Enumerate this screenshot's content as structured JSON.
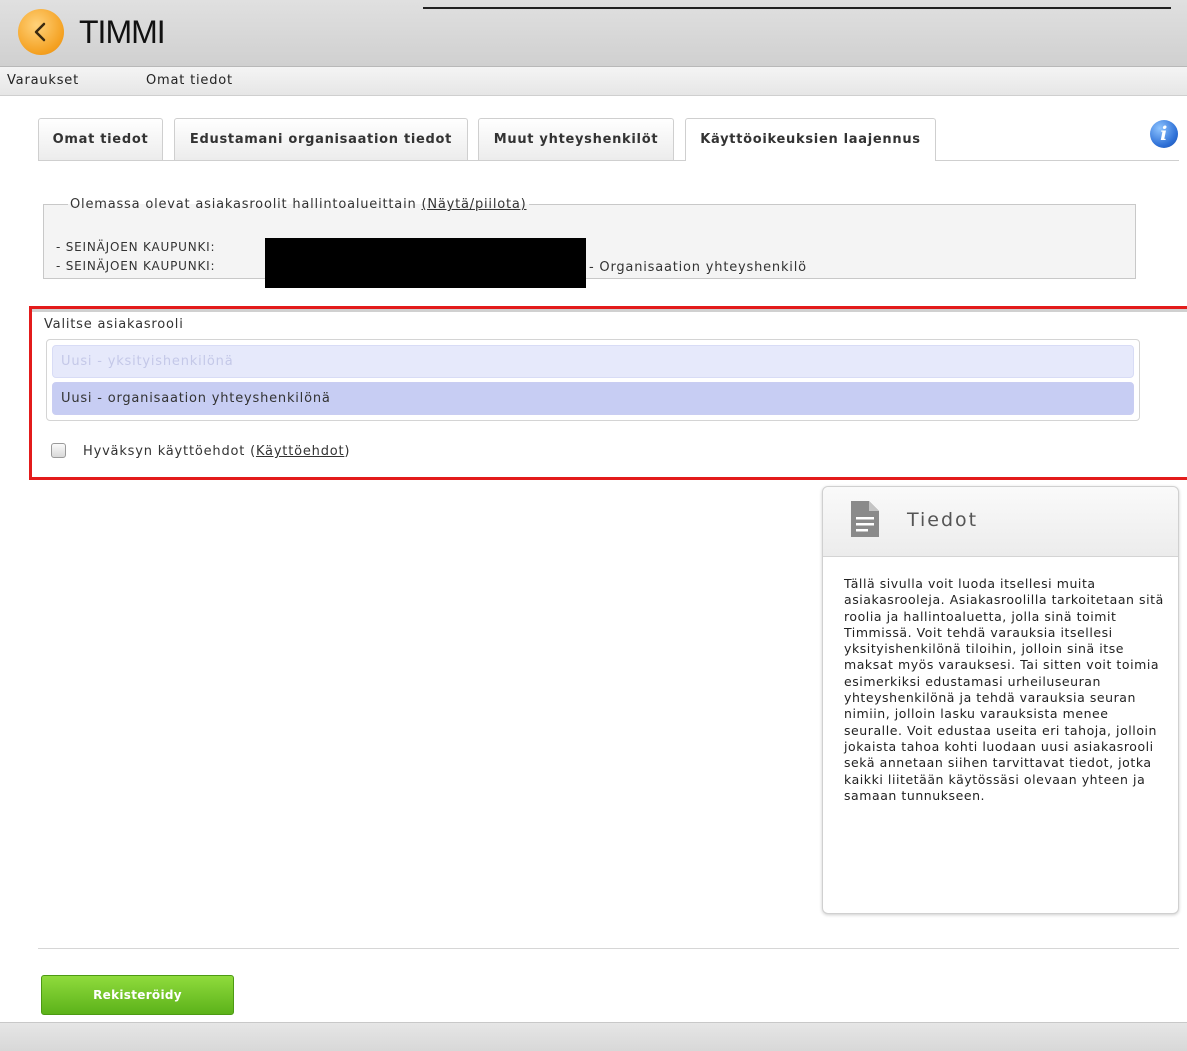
{
  "app": {
    "name": "TIMMI"
  },
  "menu": [
    "Varaukset",
    "Omat tiedot"
  ],
  "tabs": [
    {
      "label": "Omat tiedot"
    },
    {
      "label": "Edustamani organisaation tiedot"
    },
    {
      "label": "Muut yhteyshenkilöt"
    },
    {
      "label": "Käyttöoikeuksien laajennus",
      "active": true
    }
  ],
  "existing_roles": {
    "legend": "Olemassa olevat asiakasroolit hallintoalueittain",
    "toggle_link": "(Näytä/piilota)",
    "lines": [
      {
        "text": "- SEINÄJOEN KAUPUNKI:"
      },
      {
        "text": "- SEINÄJOEN KAUPUNKI:",
        "suffix": "- Organisaation yhteyshenkilö"
      }
    ]
  },
  "role_select": {
    "label": "Valitse asiakasrooli",
    "options": [
      {
        "label": "Uusi - yksityishenkilönä",
        "state": "disabled"
      },
      {
        "label": "Uusi - organisaation yhteyshenkilönä",
        "state": "selected"
      }
    ]
  },
  "terms": {
    "label": "Hyväksyn käyttöehdot (",
    "link": "Käyttöehdot",
    "label_end": ")",
    "checked": false
  },
  "info_panel": {
    "title": "Tiedot",
    "icon": "document-icon",
    "text": "Tällä sivulla voit luoda itsellesi muita asiakasrooleja. Asiakasroolilla tarkoitetaan sitä roolia ja hallintoaluetta, jolla sinä toimit Timmissä. Voit tehdä varauksia itsellesi yksityishenkilönä tiloihin, jolloin sinä itse maksat myös varauksesi. Tai sitten voit toimia esimerkiksi edustamasi urheiluseuran yhteyshenkilönä ja tehdä varauksia seuran nimiin, jolloin lasku varauksista menee seuralle. Voit edustaa useita eri tahoja, jolloin jokaista tahoa kohti luodaan uusi asiakasrooli sekä annetaan siihen tarvittavat tiedot, jotka kaikki liitetään käytössäsi olevaan yhteen ja samaan tunnukseen."
  },
  "actions": {
    "register_label": "Rekisteröidy"
  },
  "colors": {
    "highlight_border": "#e31b1b",
    "register_button": "#6cc124",
    "selected_option": "#c7cdf3",
    "logo": "#f4a020",
    "info_icon": "#2d6fd6"
  }
}
